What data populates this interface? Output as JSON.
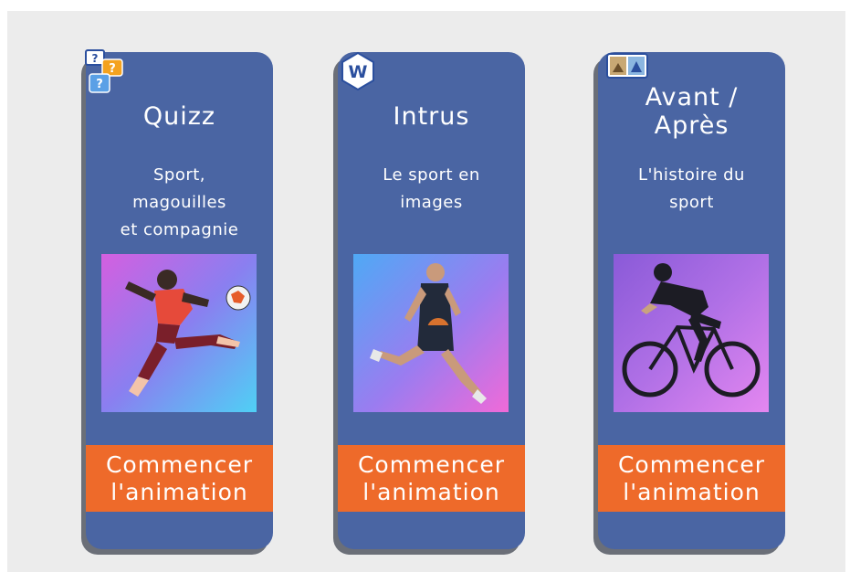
{
  "cards": [
    {
      "title": "Quizz",
      "subtitle_lines": [
        "Sport,",
        "magouilles",
        "et compagnie"
      ],
      "button_lines": [
        "Commencer",
        "l'animation"
      ],
      "icon": "quiz-icon",
      "image": "soccer-player-photo"
    },
    {
      "title": "Intrus",
      "subtitle_lines": [
        "Le sport en",
        "images"
      ],
      "button_lines": [
        "Commencer",
        "l'animation"
      ],
      "icon": "w-logo-icon",
      "image": "basketball-player-photo"
    },
    {
      "title_lines": [
        "Avant /",
        "Après"
      ],
      "subtitle_lines": [
        "L'histoire du",
        "sport"
      ],
      "button_lines": [
        "Commencer",
        "l'animation"
      ],
      "icon": "before-after-icon",
      "image": "cyclist-photo"
    }
  ],
  "colors": {
    "card": "#4a65a3",
    "button": "#ee6a2a",
    "background": "#ececec"
  }
}
